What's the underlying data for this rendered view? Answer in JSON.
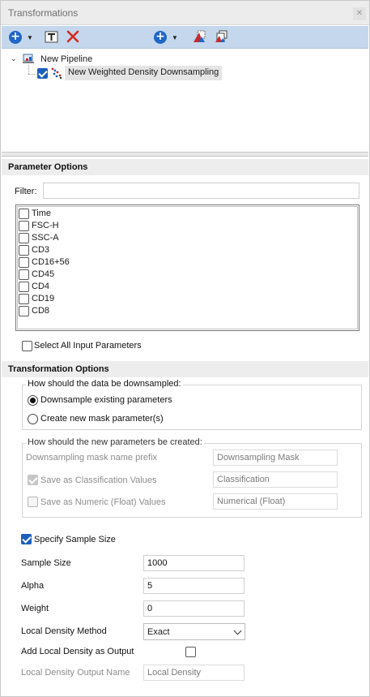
{
  "window": {
    "title": "Transformations"
  },
  "toolbar": {
    "add_icon": "circle-plus-icon",
    "rename_icon": "rename-icon",
    "delete_icon": "red-x-icon",
    "add_transform_icon": "circle-plus-icon",
    "gate_icon_1": "triangle-gate-icon",
    "gate_icon_2": "copy-gate-icon"
  },
  "tree": {
    "root_label": "New Pipeline",
    "child_label": "New Weighted Density Downsampling",
    "child_checked": true
  },
  "parameter_options": {
    "header": "Parameter Options",
    "filter_label": "Filter:",
    "filter_value": "",
    "parameters": [
      "Time",
      "FSC-H",
      "SSC-A",
      "CD3",
      "CD16+56",
      "CD45",
      "CD4",
      "CD19",
      "CD8"
    ],
    "select_all_label": "Select All Input Parameters"
  },
  "transformation_options": {
    "header": "Transformation Options",
    "downsample_group_title": "How should the data be downsampled:",
    "radio_existing": "Downsample existing parameters",
    "radio_new_mask": "Create new mask parameter(s)",
    "new_params_group_title": "How should the new parameters be created:",
    "mask_prefix_label": "Downsampling mask name prefix",
    "mask_prefix_value": "Downsampling Mask",
    "classification_label": "Save as Classification Values",
    "classification_value": "Classification",
    "numeric_label": "Save as Numeric (Float) Values",
    "numeric_value": "Numerical (Float)",
    "specify_sample_size_label": "Specify Sample Size",
    "sample_size_label": "Sample Size",
    "sample_size_value": "1000",
    "alpha_label": "Alpha",
    "alpha_value": "5",
    "weight_label": "Weight",
    "weight_value": "0",
    "local_density_method_label": "Local Density Method",
    "local_density_method_value": "Exact",
    "add_local_density_label": "Add Local Density as Output",
    "local_density_output_label": "Local Density Output Name",
    "local_density_output_value": "Local Density"
  }
}
